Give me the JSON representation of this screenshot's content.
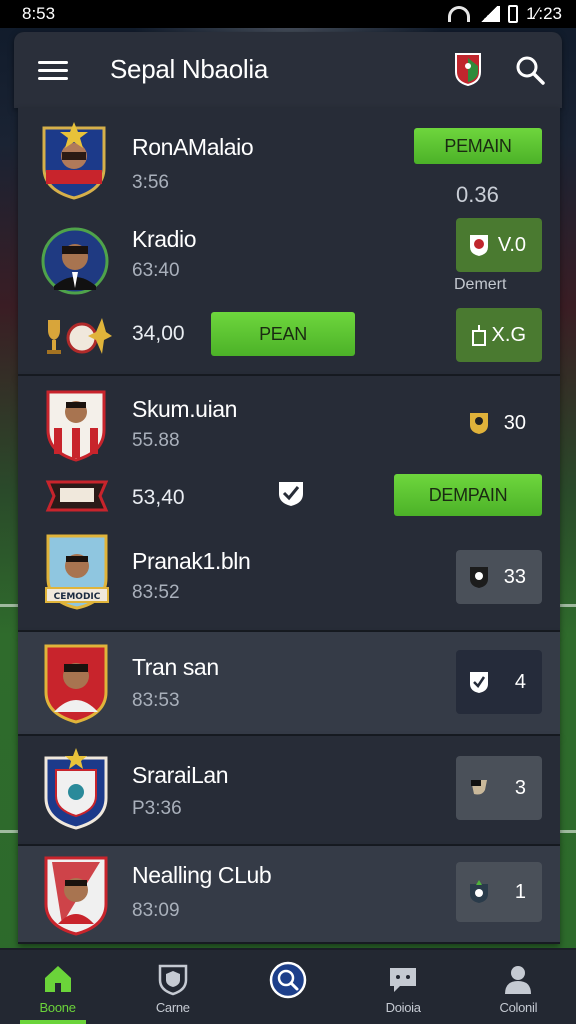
{
  "status_bar": {
    "time": "8:53",
    "right_time": "1⁄:23"
  },
  "header": {
    "title": "Sepal Nbaolia"
  },
  "matches": [
    {
      "name": "RonAMalaio",
      "sub": "3:56",
      "action_label": "PEMAIN",
      "odds": "0.36",
      "crest_label": "",
      "rows": [
        {
          "name": "Kradio",
          "sub": "63:40",
          "score_value": "V.0",
          "note": "Demert"
        },
        {
          "sub": "34,00",
          "action_label": "PEAN",
          "score_value": "X.G"
        }
      ]
    },
    {
      "name": "Skum.uian",
      "sub": "55.88",
      "score_value": "30",
      "rows": [
        {
          "sub": "53,40",
          "action_label": "DEMPAIN"
        },
        {
          "name": "Pranak1.bln",
          "sub": "83:52",
          "score_value": "33",
          "crest_label": "CEMODIC"
        }
      ]
    },
    {
      "name": "Tran san",
      "sub": "83:53",
      "score_value": "4"
    },
    {
      "name": "SraraiLan",
      "sub": "P3:36",
      "score_value": "3"
    },
    {
      "name": "Nealling CLub",
      "sub": "83:09",
      "score_value": "1"
    }
  ],
  "bottom_nav": [
    {
      "label": "Boone",
      "icon": "home-icon",
      "active": true
    },
    {
      "label": "Carne",
      "icon": "shield-icon",
      "active": false
    },
    {
      "label": "",
      "icon": "search-globe-icon",
      "active": false
    },
    {
      "label": "Doioia",
      "icon": "chat-icon",
      "active": false
    },
    {
      "label": "Colonil",
      "icon": "user-icon",
      "active": false
    }
  ],
  "colors": {
    "accent": "#6bd43a",
    "card": "#272c37",
    "header": "#2a2f3a"
  }
}
